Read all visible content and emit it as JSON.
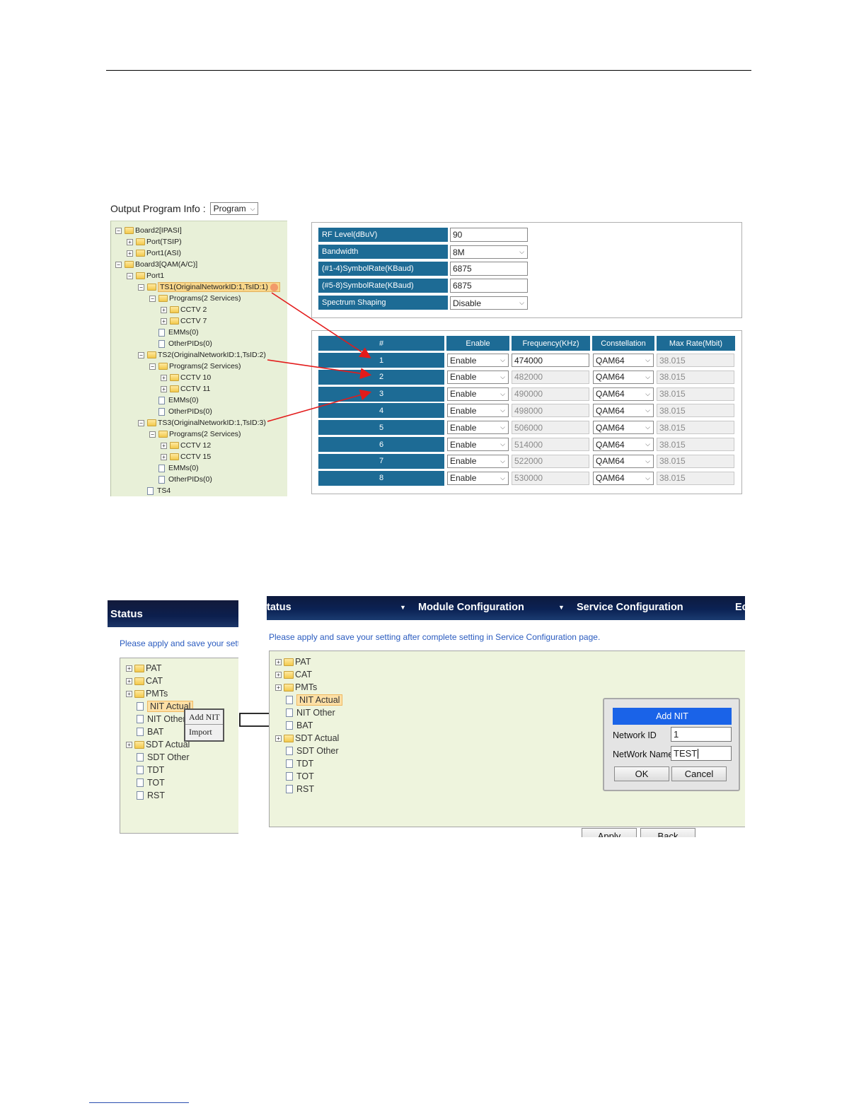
{
  "top": {
    "output_program_info_label": "Output Program Info :",
    "output_program_info_value": "Program",
    "tree": [
      {
        "label": "Board2[IPASI]",
        "toggle": "⊟",
        "type": "folder"
      },
      {
        "label": "Port(TSIP)",
        "toggle": "⊞",
        "type": "folder"
      },
      {
        "label": "Port1(ASI)",
        "toggle": "⊞",
        "type": "folder"
      },
      {
        "label": "Board3[QAM(A/C)]",
        "toggle": "⊟",
        "type": "folder"
      },
      {
        "label": "Port1",
        "toggle": "⊟",
        "type": "folder"
      },
      {
        "label": "TS1(OriginalNetworkID:1,TsID:1)",
        "toggle": "⊟",
        "type": "folder"
      },
      {
        "label": "Programs(2 Services)",
        "toggle": "⊟",
        "type": "folder"
      },
      {
        "label": "CCTV 2",
        "toggle": "⊞",
        "type": "folder"
      },
      {
        "label": "CCTV 7",
        "toggle": "⊞",
        "type": "folder"
      },
      {
        "label": "EMMs(0)",
        "type": "file"
      },
      {
        "label": "OtherPIDs(0)",
        "type": "file"
      },
      {
        "label": "TS2(OriginalNetworkID:1,TsID:2)",
        "toggle": "⊟",
        "type": "folder"
      },
      {
        "label": "Programs(2 Services)",
        "toggle": "⊟",
        "type": "folder"
      },
      {
        "label": "CCTV 10",
        "toggle": "⊞",
        "type": "folder"
      },
      {
        "label": "CCTV 11",
        "toggle": "⊞",
        "type": "folder"
      },
      {
        "label": "EMMs(0)",
        "type": "file"
      },
      {
        "label": "OtherPIDs(0)",
        "type": "file"
      },
      {
        "label": "TS3(OriginalNetworkID:1,TsID:3)",
        "toggle": "⊟",
        "type": "folder"
      },
      {
        "label": "Programs(2 Services)",
        "toggle": "⊟",
        "type": "folder"
      },
      {
        "label": "CCTV 12",
        "toggle": "⊞",
        "type": "folder"
      },
      {
        "label": "CCTV 15",
        "toggle": "⊞",
        "type": "folder"
      },
      {
        "label": "EMMs(0)",
        "type": "file"
      },
      {
        "label": "OtherPIDs(0)",
        "type": "file"
      },
      {
        "label": "TS4",
        "type": "file"
      }
    ],
    "rf_settings": [
      {
        "label": "RF Level(dBuV)",
        "value": "90",
        "kind": "input"
      },
      {
        "label": "Bandwidth",
        "value": "8M",
        "kind": "select"
      },
      {
        "label": "(#1-4)SymbolRate(KBaud)",
        "value": "6875",
        "kind": "input"
      },
      {
        "label": "(#5-8)SymbolRate(KBaud)",
        "value": "6875",
        "kind": "input"
      },
      {
        "label": "Spectrum Shaping",
        "value": "Disable",
        "kind": "select"
      }
    ],
    "channel_table": {
      "headers": [
        "#",
        "Enable",
        "Frequency(KHz)",
        "Constellation",
        "Max Rate(Mbit)"
      ],
      "rows": [
        {
          "num": "1",
          "enable": "Enable",
          "freq": "474000",
          "const": "QAM64",
          "rate": "38.015"
        },
        {
          "num": "2",
          "enable": "Enable",
          "freq": "482000",
          "const": "QAM64",
          "rate": "38.015"
        },
        {
          "num": "3",
          "enable": "Enable",
          "freq": "490000",
          "const": "QAM64",
          "rate": "38.015"
        },
        {
          "num": "4",
          "enable": "Enable",
          "freq": "498000",
          "const": "QAM64",
          "rate": "38.015"
        },
        {
          "num": "5",
          "enable": "Enable",
          "freq": "506000",
          "const": "QAM64",
          "rate": "38.015"
        },
        {
          "num": "6",
          "enable": "Enable",
          "freq": "514000",
          "const": "QAM64",
          "rate": "38.015"
        },
        {
          "num": "7",
          "enable": "Enable",
          "freq": "522000",
          "const": "QAM64",
          "rate": "38.015"
        },
        {
          "num": "8",
          "enable": "Enable",
          "freq": "530000",
          "const": "QAM64",
          "rate": "38.015"
        }
      ]
    }
  },
  "bottom_left": {
    "status_title": "Status",
    "notice": "Please apply and save your setti",
    "tree": [
      "PAT",
      "CAT",
      "PMTs",
      "NIT Actual",
      "NIT Other",
      "BAT",
      "SDT Actual",
      "SDT Other",
      "TDT",
      "TOT",
      "RST"
    ],
    "context_menu": [
      "Add NIT",
      "Import"
    ]
  },
  "bottom_right": {
    "nav": [
      "tatus",
      "Module Configuration",
      "Service Configuration",
      "Ec"
    ],
    "notice": "Please apply and save your setting after complete setting in Service Configuration page.",
    "tree": [
      "PAT",
      "CAT",
      "PMTs",
      "NIT Actual",
      "NIT Other",
      "BAT",
      "SDT Actual",
      "SDT Other",
      "TDT",
      "TOT",
      "RST"
    ],
    "dialog": {
      "title": "Add NIT",
      "network_id_label": "Network ID",
      "network_id_value": "1",
      "network_name_label": "NetWork Name",
      "network_name_value": "TEST",
      "ok": "OK",
      "cancel": "Cancel"
    },
    "apply": "Apply",
    "back": "Back"
  },
  "colors": {
    "header_blue": "#1d6b95",
    "arrow_red": "#e31b1b",
    "dialog_blue": "#1a63e8"
  }
}
